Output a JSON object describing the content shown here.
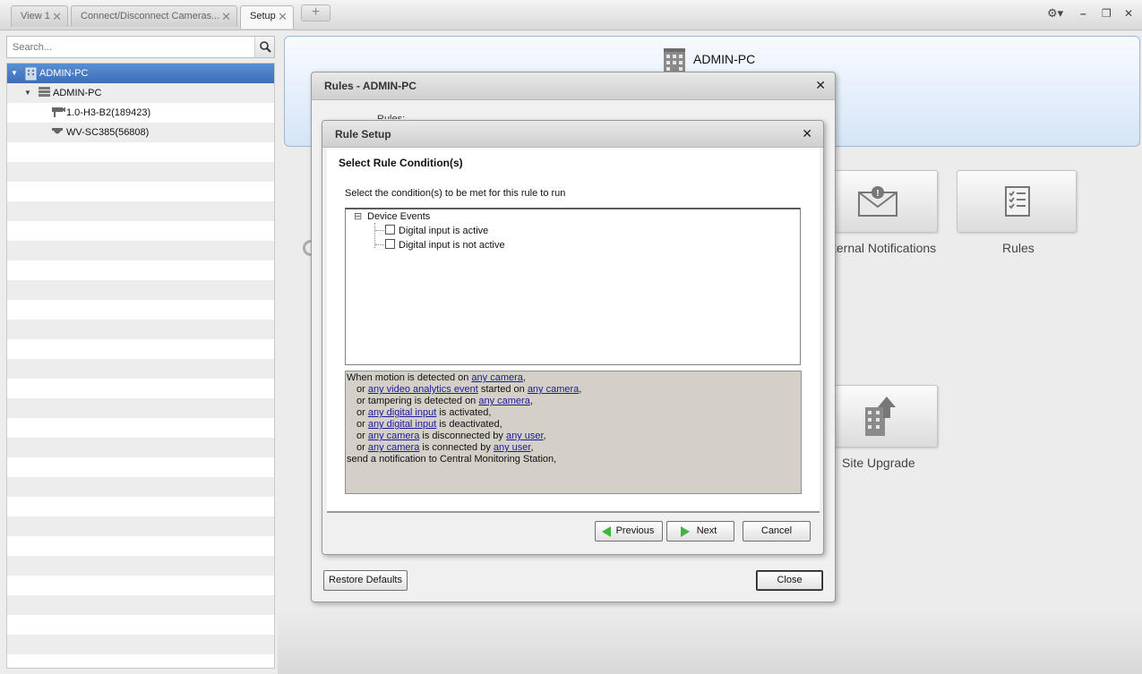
{
  "tabs": [
    {
      "label": "View 1",
      "close": "✕"
    },
    {
      "label": "Connect/Disconnect Cameras...",
      "close": "✕"
    },
    {
      "label": "Setup",
      "close": "✕"
    }
  ],
  "add_tab": "+",
  "window_controls": {
    "settings": "⚙▾",
    "minimize": "–",
    "restore": "❐",
    "close": "✕"
  },
  "search": {
    "placeholder": "Search..."
  },
  "tree": {
    "items": [
      {
        "label": "ADMIN-PC",
        "level": 0,
        "selected": true
      },
      {
        "label": "ADMIN-PC",
        "level": 1
      },
      {
        "label": "1.0-H3-B2(189423)",
        "level": 2
      },
      {
        "label": "WV-SC385(56808)",
        "level": 2
      }
    ]
  },
  "banner": {
    "title": "ADMIN-PC"
  },
  "tiles": {
    "notifications": "ternal Notifications",
    "rules": "Rules",
    "site_upgrade": "Site Upgrade"
  },
  "rules_dialog": {
    "title": "Rules - ADMIN-PC",
    "partial_label": "Rules:",
    "restore_defaults": "Restore Defaults",
    "close_button": "Close"
  },
  "rule_setup": {
    "title": "Rule Setup",
    "heading": "Select Rule Condition(s)",
    "instruction": "Select the condition(s) to be met for this rule to run",
    "group": {
      "expander": "⊟",
      "label": "Device Events"
    },
    "conditions": [
      {
        "label": "Digital input is active",
        "checked": false
      },
      {
        "label": "Digital input is not active",
        "checked": false
      }
    ],
    "summary": {
      "l1": {
        "pre": "When motion is detected on ",
        "link1": "any camera",
        "post": ","
      },
      "l2": {
        "pre": "or ",
        "link1": "any video analytics event",
        "mid": " started on ",
        "link2": "any camera",
        "post": ","
      },
      "l3": {
        "pre": "or tampering is detected on ",
        "link1": "any camera",
        "post": ","
      },
      "l4": {
        "pre": "or ",
        "link1": "any digital input",
        "post": " is activated,"
      },
      "l5": {
        "pre": "or ",
        "link1": "any digital input",
        "post": " is deactivated,"
      },
      "l6": {
        "pre": "or ",
        "link1": "any camera",
        "mid": " is disconnected by ",
        "link2": "any user",
        "post": ","
      },
      "l7": {
        "pre": "or ",
        "link1": "any camera",
        "mid": " is connected by ",
        "link2": "any user",
        "post": ","
      },
      "l8": {
        "pre": "send a notification to Central Monitoring Station,"
      }
    },
    "buttons": {
      "previous": "Previous",
      "next": "Next",
      "cancel": "Cancel"
    }
  }
}
